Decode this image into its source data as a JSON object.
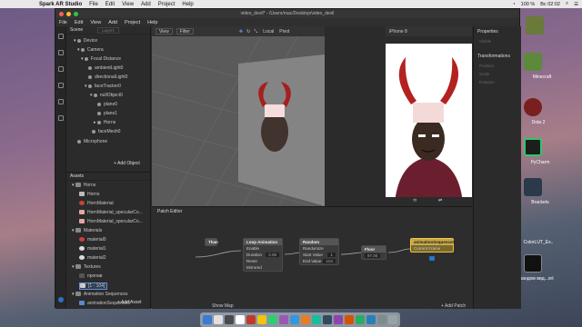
{
  "menubar": {
    "app": "Spark AR Studio",
    "items": [
      "File",
      "Edit",
      "View",
      "Add",
      "Project",
      "Help"
    ],
    "right": {
      "battery": "100 %",
      "clock": "Вс 02:02"
    }
  },
  "window": {
    "title": "video_devil* - /Users/mac/Desktop/video_devil"
  },
  "appmenu": [
    "File",
    "Edit",
    "View",
    "Add",
    "Project",
    "Help"
  ],
  "scene": {
    "title": "Scene",
    "layers_label": "Layers",
    "nodes": [
      "Device",
      "Camera",
      "Focal Distance",
      "ambientLight0",
      "directionalLight0",
      "faceTracker0",
      "nullObject0",
      "plane0",
      "plane1",
      "Horns",
      "faceMesh0",
      "Microphone"
    ],
    "add_label": "+ Add Object"
  },
  "assets": {
    "title": "Assets",
    "items": [
      "Horns",
      "Horns",
      "HornMaterial",
      "HornMaterial_specularCo...",
      "HornMaterial_specularCo...",
      "Materials",
      "material0",
      "material1",
      "material2",
      "Textures",
      "пропав",
      "[1 - 104]",
      "Animation Sequences",
      "animationSequence0"
    ],
    "add_label": "+ Add Asset"
  },
  "viewport": {
    "view_label": "View",
    "filter_label": "Filter",
    "local_label": "Local",
    "pivot_label": "Pivot"
  },
  "preview": {
    "device": "iPhone 8"
  },
  "properties": {
    "title": "Properties",
    "visible_label": "Visible",
    "transformations": "Transformations",
    "position": "Position",
    "scale": "Scale",
    "rotation": "Rotation"
  },
  "patch": {
    "title": "Patch Editor",
    "show_map": "Show Map",
    "add_patch": "+ Add Patch",
    "nodes": {
      "than": {
        "title": "Than"
      },
      "loop": {
        "title": "Loop Animation",
        "rows": [
          [
            "Enable",
            ""
          ],
          [
            "Duration",
            "0.08"
          ],
          [
            "Reset",
            ""
          ],
          [
            "Mirrored",
            ""
          ]
        ]
      },
      "random": {
        "title": "Random",
        "rows": [
          [
            "Randomize",
            ""
          ],
          [
            "Start Value",
            "1"
          ],
          [
            "End Value",
            "104"
          ]
        ]
      },
      "floor": {
        "title": "Floor",
        "value": "97.00"
      },
      "anim": {
        "title": "animationSequence0",
        "row": "Current Frame"
      }
    }
  },
  "dock_count": 18,
  "desktop_icons": [
    "Minecraft",
    "Dota 2",
    "PyCharm",
    "Brackets",
    "ColorLUT_Ex..",
    "рандом вид...ort"
  ]
}
